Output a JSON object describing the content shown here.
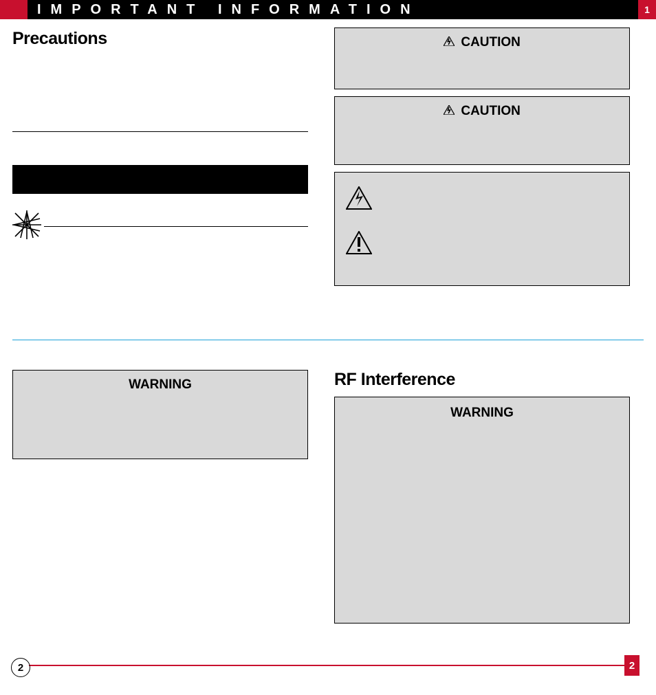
{
  "header": {
    "title": "IMPORTANT INFORMATION",
    "page_top": "1"
  },
  "left": {
    "section_title": "Precautions"
  },
  "right_callouts": {
    "box1_title": "CAUTION",
    "box2_title": "CAUTION"
  },
  "lower_left_box": {
    "title": "WARNING"
  },
  "lower_right": {
    "section_title": "RF Interference",
    "box_title": "WARNING"
  },
  "footer": {
    "left_page": "2",
    "right_page": "2"
  }
}
